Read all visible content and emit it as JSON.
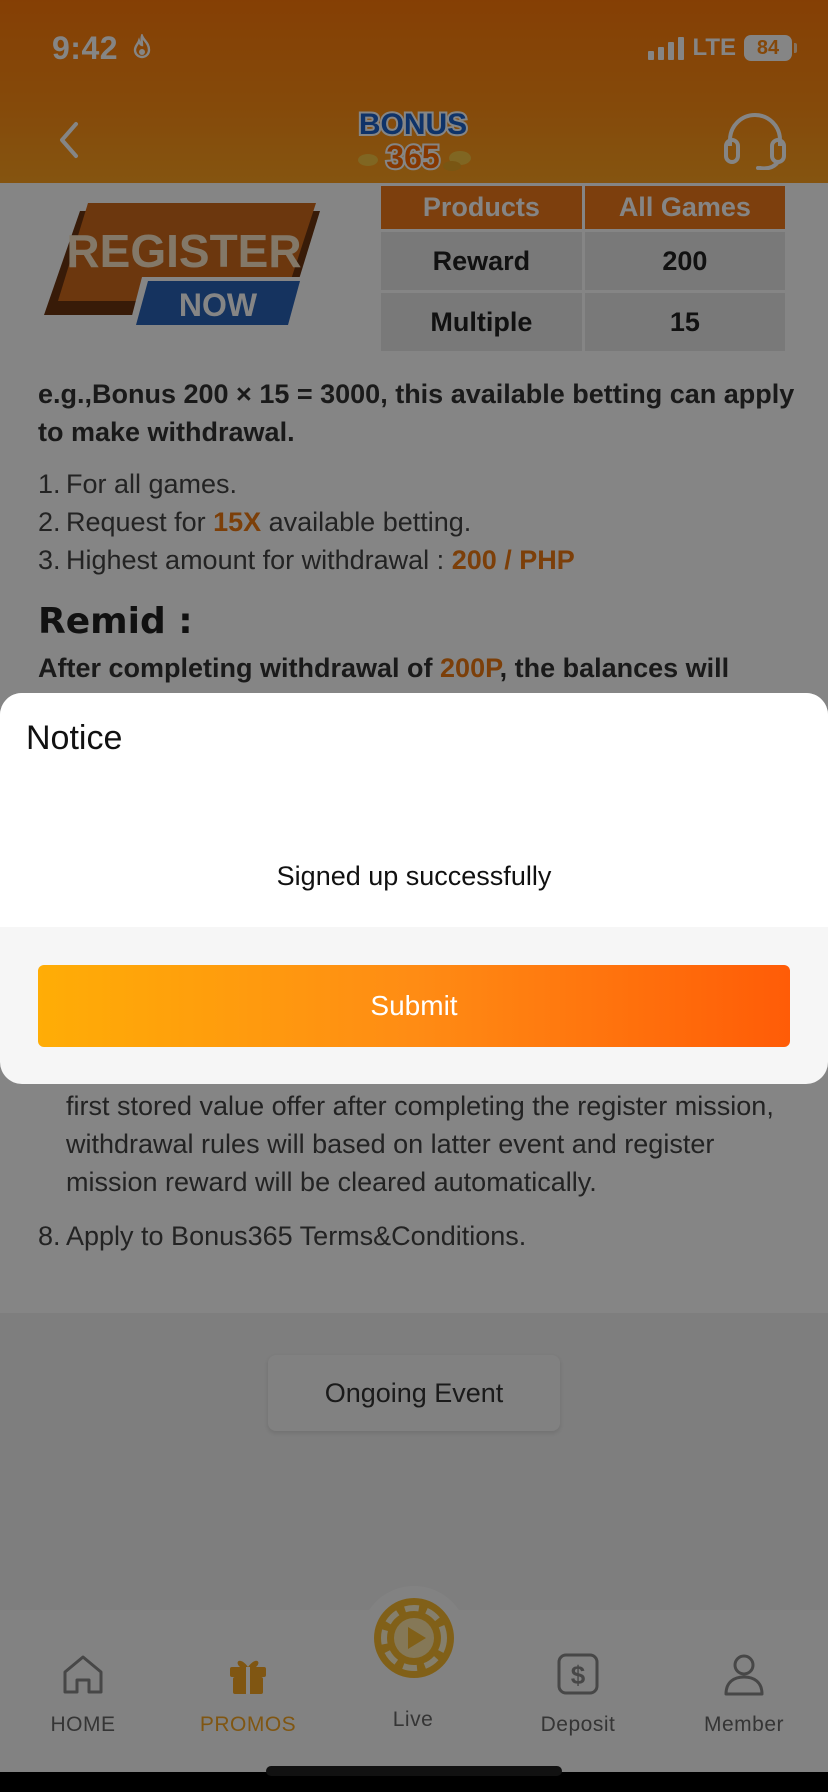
{
  "status_bar": {
    "time": "9:42",
    "network": "LTE",
    "battery": "84"
  },
  "header": {
    "logo_line1": "BONUS",
    "logo_line2": "365"
  },
  "banner": {
    "line1": "REGISTER",
    "line2": "NOW"
  },
  "table": {
    "headers": [
      "Products",
      "All Games"
    ],
    "rows": [
      [
        "Reward",
        "200"
      ],
      [
        "Multiple",
        "15"
      ]
    ]
  },
  "description": "e.g.,Bonus 200 × 15 = 3000, this available betting can apply to make  withdrawal.",
  "rules": [
    {
      "num": "1.",
      "text": "For all games."
    },
    {
      "num": "2.",
      "pre": "Request for ",
      "hl": "15X",
      "post": " available betting."
    },
    {
      "num": "3.",
      "pre": "Highest amount for withdrawal : ",
      "hl": "200  / PHP",
      "post": ""
    }
  ],
  "remid": {
    "title": "Remid :",
    "pre": "After completing withdrawal of ",
    "hl": "200P",
    "post": ", the balances will"
  },
  "rule7_text": "first stored value offer after completing the register mission, withdrawal rules will based on latter event and register mission reward will be cleared automatically.",
  "rule8": {
    "num": "8.",
    "text": "Apply to Bonus365 Terms&Conditions."
  },
  "ongoing_button": "Ongoing Event",
  "modal": {
    "title": "Notice",
    "message": "Signed up successfully",
    "submit": "Submit"
  },
  "nav": {
    "items": [
      {
        "label": "HOME",
        "icon": "home-icon"
      },
      {
        "label": "PROMOS",
        "icon": "gift-icon",
        "active": true
      },
      {
        "label": "Live",
        "icon": "live-play-icon"
      },
      {
        "label": "Deposit",
        "icon": "dollar-icon"
      },
      {
        "label": "Member",
        "icon": "user-icon"
      }
    ]
  },
  "colors": {
    "brand_orange": "#ff7a0a",
    "highlight": "#ee7a12",
    "active_nav": "#f5a623"
  }
}
